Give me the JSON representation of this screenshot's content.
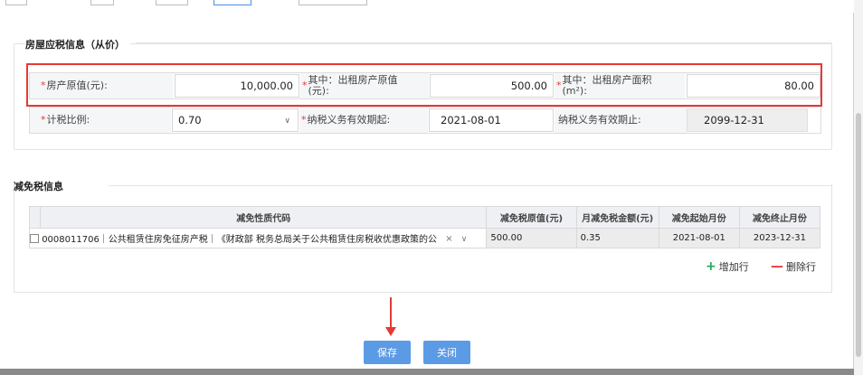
{
  "house_section": {
    "title": "房屋应税信息（从价）",
    "row1": {
      "original_value_label": "房产原值(元):",
      "original_value": "10,000.00",
      "rented_value_label": "其中：出租房产原值(元):",
      "rented_value": "500.00",
      "rented_area_label": "其中：出租房产面积(m²):",
      "rented_area": "80.00"
    },
    "row2": {
      "tax_ratio_label": "计税比例:",
      "tax_ratio": "0.70",
      "start_label": "纳税义务有效期起:",
      "start_value": "2021-08-01",
      "end_label": "纳税义务有效期止:",
      "end_value": "2099-12-31"
    }
  },
  "relief_section": {
    "title": "减免税信息",
    "columns": [
      "减免性质代码",
      "减免税原值(元)",
      "月减免税金额(元)",
      "减免起始月份",
      "减免终止月份"
    ],
    "rows": [
      {
        "code": "0008011706｜公共租赁住房免征房产税｜《财政部 税务总局关于公共租赁住房税收优惠政策的公",
        "original": "500.00",
        "monthly": "0.35",
        "start": "2021-08-01",
        "end": "2023-12-31"
      }
    ],
    "add_row": "增加行",
    "delete_row": "删除行"
  },
  "buttons": {
    "save": "保存",
    "close": "关闭"
  },
  "colors": {
    "required": "#e53935",
    "primary_button": "#5b9be6",
    "add": "#21a95c",
    "highlight": "#e53935"
  }
}
